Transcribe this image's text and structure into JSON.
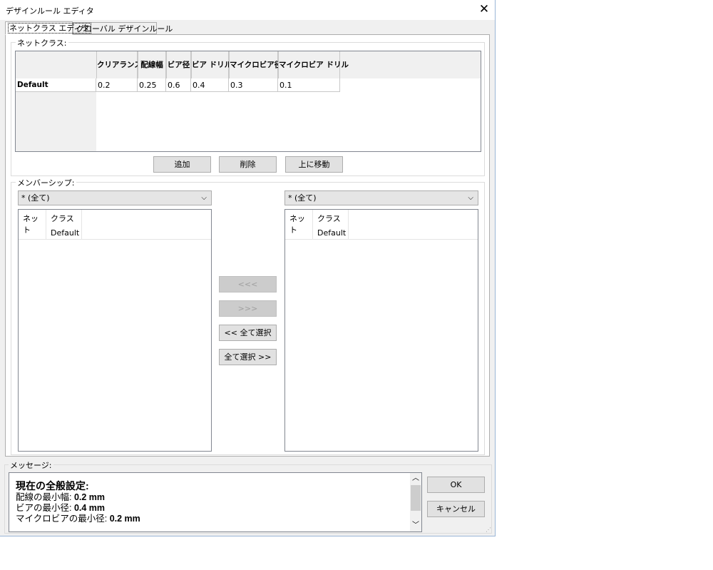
{
  "window": {
    "title": "デザインルール エディタ",
    "close_glyph": "✕"
  },
  "tabs": [
    {
      "label": "ネットクラス エディタ",
      "active": true
    },
    {
      "label": "グローバル デザインルール",
      "active": false
    }
  ],
  "netclasses": {
    "group_label": "ネットクラス:",
    "columns": [
      "クリアランス",
      "配線幅",
      "ビア径",
      "ビア ドリル",
      "マイクロビア径",
      "マイクロビア ドリル"
    ],
    "rows": [
      {
        "name": "Default",
        "cells": [
          "0.2",
          "0.25",
          "0.6",
          "0.4",
          "0.3",
          "0.1"
        ]
      }
    ],
    "buttons": {
      "add": "追加",
      "delete": "削除",
      "move_up": "上に移動"
    }
  },
  "membership": {
    "group_label": "メンバーシップ:",
    "left_filter": "* (全て)",
    "right_filter": "* (全て)",
    "list_headers": {
      "net": "ネット",
      "class": "クラス",
      "default_value": "Default"
    },
    "buttons": {
      "move_left": "<<<",
      "move_right": ">>>",
      "select_all_left": "<< 全て選択",
      "select_all_right": "全て選択 >>"
    }
  },
  "messages": {
    "group_label": "メッセージ:",
    "heading": "現在の全般設定:",
    "lines": [
      {
        "label": "配線の最小幅: ",
        "value": "0.2 mm"
      },
      {
        "label": "ビアの最小径: ",
        "value": "0.4 mm"
      },
      {
        "label": "マイクロビアの最小径: ",
        "value": "0.2 mm"
      }
    ]
  },
  "dialog_buttons": {
    "ok": "OK",
    "cancel": "キャンセル"
  }
}
